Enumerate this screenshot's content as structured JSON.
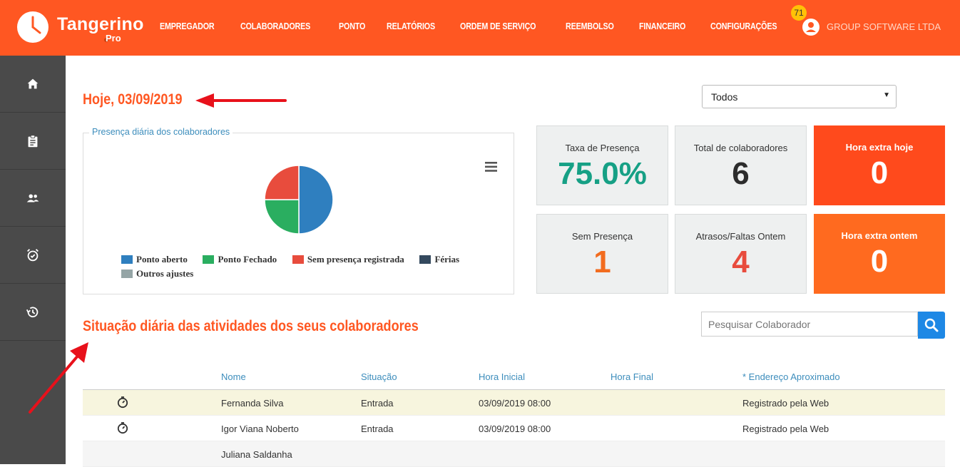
{
  "header": {
    "logo_name": "Tangerino",
    "logo_sub": "Pro",
    "nav": [
      "EMPREGADOR",
      "COLABORADORES",
      "PONTO",
      "RELATÓRIOS",
      "ORDEM DE SERVIÇO",
      "REEMBOLSO",
      "FINANCEIRO",
      "CONFIGURAÇÕES"
    ],
    "notification_count": "71",
    "company": "GROUP SOFTWARE LTDA"
  },
  "sidebar": {
    "icons": [
      "home-icon",
      "clipboard-icon",
      "people-icon",
      "alarm-icon",
      "history-icon"
    ]
  },
  "main": {
    "title": "Hoje, 03/09/2019",
    "filter_value": "Todos",
    "section_title": "Situação diária das atividades dos seus colaboradores",
    "search_placeholder": "Pesquisar Colaborador"
  },
  "chart_data": {
    "type": "pie",
    "title": "Presença diária dos colaboradores",
    "categories": [
      "Ponto aberto",
      "Ponto Fechado",
      "Sem presença registrada",
      "Férias",
      "Outros ajustes"
    ],
    "values": [
      50,
      25,
      25,
      0,
      0
    ],
    "colors": [
      "#2f7fbf",
      "#2aae60",
      "#e84c3d",
      "#34495e",
      "#95a5a6"
    ]
  },
  "stats": [
    {
      "label": "Taxa de Presença",
      "value": "75.0%",
      "color": "#16a085"
    },
    {
      "label": "Total de colaboradores",
      "value": "6",
      "color": "#2c2c2c"
    },
    {
      "label": "Hora extra hoje",
      "value": "0",
      "color": "#fff"
    },
    {
      "label": "Sem Presença",
      "value": "1",
      "color": "#f26c1f"
    },
    {
      "label": "Atrasos/Faltas Ontem",
      "value": "4",
      "color": "#e84c3d"
    },
    {
      "label": "Hora extra ontem",
      "value": "0",
      "color": "#fff"
    }
  ],
  "table": {
    "headers": [
      "Nome",
      "Situação",
      "Hora Inicial",
      "Hora Final",
      "* Endereço Aproximado"
    ],
    "rows": [
      {
        "nome": "Fernanda Silva",
        "situacao": "Entrada",
        "hora_inicial": "03/09/2019 08:00",
        "hora_final": "",
        "endereco": "Registrado pela Web"
      },
      {
        "nome": "Igor Viana Noberto",
        "situacao": "Entrada",
        "hora_inicial": "03/09/2019 08:00",
        "hora_final": "",
        "endereco": "Registrado pela Web"
      },
      {
        "nome": "Juliana Saldanha",
        "situacao": "",
        "hora_inicial": "",
        "hora_final": "",
        "endereco": ""
      }
    ]
  }
}
